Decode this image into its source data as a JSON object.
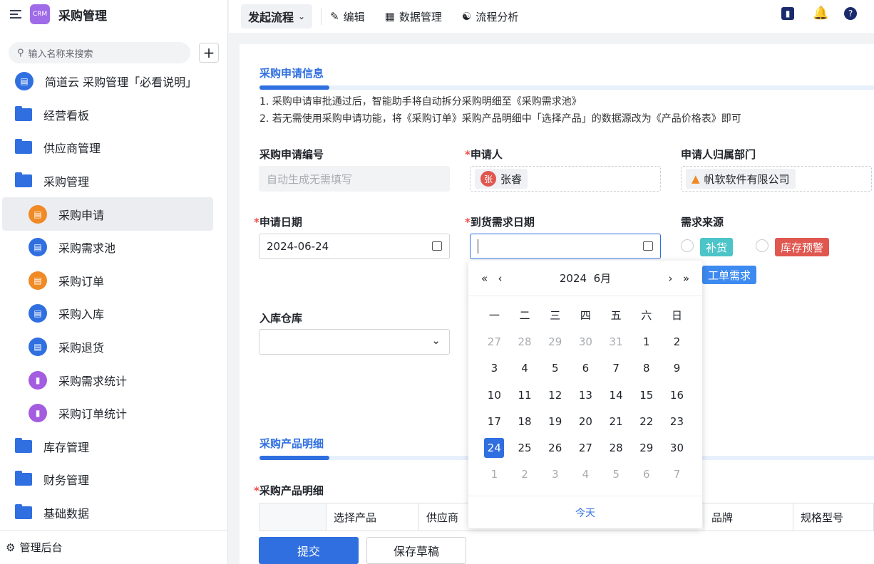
{
  "app": {
    "title": "采购管理",
    "logo_text": "CRM"
  },
  "search": {
    "placeholder": "输入名称来搜索"
  },
  "sidebar": {
    "items": [
      {
        "label": "简道云 采购管理「必看说明」",
        "icon": "doc-icon",
        "color": "#2f6fe0",
        "level": 0,
        "type": "form"
      },
      {
        "label": "经营看板",
        "icon": "folder-icon",
        "level": 0,
        "type": "folder"
      },
      {
        "label": "供应商管理",
        "icon": "folder-icon",
        "level": 0,
        "type": "folder"
      },
      {
        "label": "采购管理",
        "icon": "folder-open-icon",
        "level": 0,
        "type": "folder"
      },
      {
        "label": "采购申请",
        "icon": "clipboard-icon",
        "color": "#f08a24",
        "level": 1,
        "type": "form",
        "active": true
      },
      {
        "label": "采购需求池",
        "icon": "clipboard-icon",
        "color": "#2f6fe0",
        "level": 1,
        "type": "form"
      },
      {
        "label": "采购订单",
        "icon": "clipboard-icon",
        "color": "#f08a24",
        "level": 1,
        "type": "form"
      },
      {
        "label": "采购入库",
        "icon": "doc-icon",
        "color": "#2f6fe0",
        "level": 1,
        "type": "form"
      },
      {
        "label": "采购退货",
        "icon": "doc-icon",
        "color": "#2f6fe0",
        "level": 1,
        "type": "form"
      },
      {
        "label": "采购需求统计",
        "icon": "bar-chart-icon",
        "color": "#a45ce0",
        "level": 1,
        "type": "form"
      },
      {
        "label": "采购订单统计",
        "icon": "bar-chart-icon",
        "color": "#a45ce0",
        "level": 1,
        "type": "form"
      },
      {
        "label": "库存管理",
        "icon": "folder-icon",
        "level": 0,
        "type": "folder"
      },
      {
        "label": "财务管理",
        "icon": "folder-icon",
        "level": 0,
        "type": "folder"
      },
      {
        "label": "基础数据",
        "icon": "folder-icon",
        "level": 0,
        "type": "folder"
      }
    ],
    "admin": "管理后台"
  },
  "toolbar": {
    "launch": "发起流程",
    "edit": "编辑",
    "data": "数据管理",
    "analysis": "流程分析"
  },
  "form": {
    "section1": "采购申请信息",
    "notes": [
      "1. 采购申请审批通过后，智能助手将自动拆分采购明细至《采购需求池》",
      "2. 若无需使用采购申请功能，将《采购订单》采购产品明细中「选择产品」的数据源改为《产品价格表》即可"
    ],
    "req_no_label": "采购申请编号",
    "req_no_placeholder": "自动生成无需填写",
    "applicant_label": "申请人",
    "applicant": "张睿",
    "applicant_avatar": "张",
    "dept_label": "申请人归属部门",
    "dept": "帆软软件有限公司",
    "date_label": "申请日期",
    "date": "2024-06-24",
    "arrival_label": "到货需求日期",
    "source_label": "需求来源",
    "sources": [
      {
        "label": "补货",
        "color": "#4cc4c8"
      },
      {
        "label": "库存预警",
        "color": "#e0574f"
      },
      {
        "label": "工单需求",
        "color": "#3d8af0"
      }
    ],
    "warehouse_label": "入库仓库",
    "section2": "采购产品明细",
    "detail_label": "采购产品明细",
    "columns": [
      "选择产品",
      "供应商",
      "品牌",
      "规格型号"
    ],
    "submit": "提交",
    "draft": "保存草稿"
  },
  "calendar": {
    "year": "2024",
    "month": "6月",
    "weekdays": [
      "一",
      "二",
      "三",
      "四",
      "五",
      "六",
      "日"
    ],
    "days": [
      [
        "27",
        "28",
        "29",
        "30",
        "31",
        "1",
        "2"
      ],
      [
        "3",
        "4",
        "5",
        "6",
        "7",
        "8",
        "9"
      ],
      [
        "10",
        "11",
        "12",
        "13",
        "14",
        "15",
        "16"
      ],
      [
        "17",
        "18",
        "19",
        "20",
        "21",
        "22",
        "23"
      ],
      [
        "24",
        "25",
        "26",
        "27",
        "28",
        "29",
        "30"
      ],
      [
        "1",
        "2",
        "3",
        "4",
        "5",
        "6",
        "7"
      ]
    ],
    "selected": "24",
    "today": "今天"
  }
}
